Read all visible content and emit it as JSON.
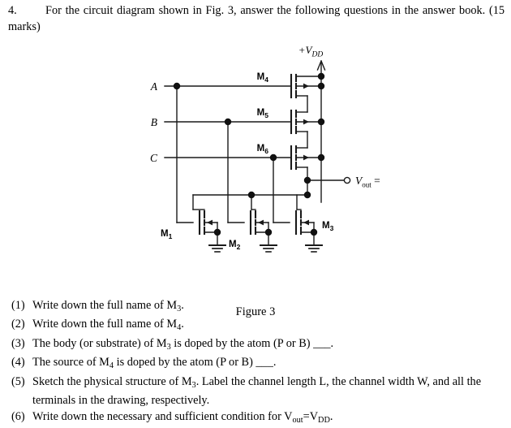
{
  "intro": {
    "number": "4.",
    "text": "For the circuit diagram shown in Fig. 3, answer the following questions in the answer book. (15 marks)"
  },
  "figure": {
    "caption": "Figure 3",
    "supply_label_prefix": "+V",
    "supply_label_sub": "DD",
    "output_label_main": "V",
    "output_label_sub": "out",
    "output_label_suffix": "=",
    "inputs": [
      {
        "name": "A",
        "label": "A"
      },
      {
        "name": "B",
        "label": "B"
      },
      {
        "name": "C",
        "label": "C"
      }
    ],
    "devices": [
      {
        "name": "M1",
        "label_main": "M",
        "label_sub": "1",
        "type": "nmos"
      },
      {
        "name": "M2",
        "label_main": "M",
        "label_sub": "2",
        "type": "nmos"
      },
      {
        "name": "M3",
        "label_main": "M",
        "label_sub": "3",
        "type": "nmos"
      },
      {
        "name": "M4",
        "label_main": "M",
        "label_sub": "4",
        "type": "pmos"
      },
      {
        "name": "M5",
        "label_main": "M",
        "label_sub": "5",
        "type": "pmos"
      },
      {
        "name": "M6",
        "label_main": "M",
        "label_sub": "6",
        "type": "pmos"
      }
    ],
    "colors": {
      "wire": "#1a1a1a",
      "node": "#111111",
      "background": "#ffffff"
    }
  },
  "questions": [
    {
      "label": "(1)",
      "text": "Write down the full name of M<sub>3</sub>."
    },
    {
      "label": "(2)",
      "text": "Write down the full name of M<sub>4</sub>."
    },
    {
      "label": "(3)",
      "text": "The body (or substrate) of M<sub>3</sub> is doped by the atom (P or B) ___."
    },
    {
      "label": "(4)",
      "text": "The source of M<sub>4</sub> is doped by the atom (P or B) ___."
    },
    {
      "label": "(5)",
      "text": "Sketch the physical structure of M<sub>3</sub>. Label the channel length L, the channel width W, and all the terminals in the drawing, respectively."
    },
    {
      "label": "(6)",
      "text": "Write down the necessary and sufficient condition for V<sub>out</sub>=V<sub>DD</sub>."
    }
  ]
}
